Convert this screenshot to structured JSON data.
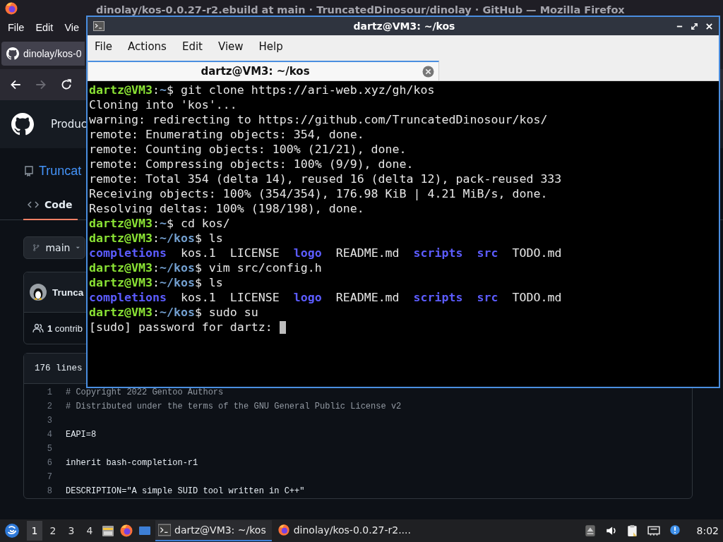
{
  "browser": {
    "title": "dinolay/kos-0.0.27-r2.ebuild at main · TruncatedDinosour/dinolay · GitHub — Mozilla Firefox",
    "menu": [
      {
        "label": "File"
      },
      {
        "label": "Edit"
      },
      {
        "label": "Vie"
      }
    ],
    "tab": {
      "title": "dinolay/kos-0"
    },
    "nav": [
      {
        "kind": "back",
        "disabled": false
      },
      {
        "kind": "forward",
        "disabled": true
      },
      {
        "kind": "reload",
        "disabled": false
      }
    ],
    "github": {
      "header_item": "Produc",
      "repo": "Truncat",
      "tabs": [
        {
          "label": "Code",
          "selected": true
        }
      ],
      "branch": "main",
      "commit_author": "Trunca",
      "contributors_count": "1",
      "contributors_label": "contrib",
      "file_lines": "176 lines",
      "code": [
        {
          "n": "1",
          "kind": "comment",
          "text": "# Copyright 2022 Gentoo Authors"
        },
        {
          "n": "2",
          "kind": "comment",
          "text": "# Distributed under the terms of the GNU General Public License v2"
        },
        {
          "n": "3",
          "kind": "blank"
        },
        {
          "n": "4",
          "kind": "code",
          "text": "EAPI=8"
        },
        {
          "n": "5",
          "kind": "blank"
        },
        {
          "n": "6",
          "kind": "code",
          "text": "inherit bash-completion-r1"
        },
        {
          "n": "7",
          "kind": "blank"
        },
        {
          "n": "8",
          "kind": "code",
          "text": "DESCRIPTION=\"A simple SUID tool written in C++\""
        }
      ]
    }
  },
  "terminal": {
    "title": "dartz@VM3: ~/kos",
    "menu": [
      {
        "label": "File"
      },
      {
        "label": "Actions"
      },
      {
        "label": "Edit"
      },
      {
        "label": "View"
      },
      {
        "label": "Help"
      }
    ],
    "tabs": [
      {
        "title": "dartz@VM3: ~/kos",
        "selected": true
      }
    ],
    "lines": [
      {
        "segments": [
          {
            "kind": "user",
            "text": "dartz@VM3"
          },
          {
            "kind": "plain",
            "text": ":"
          },
          {
            "kind": "path",
            "text": "~"
          },
          {
            "kind": "plain",
            "text": "$ git clone https://ari-web.xyz/gh/kos"
          }
        ]
      },
      {
        "segments": [
          {
            "kind": "plain",
            "text": "Cloning into 'kos'..."
          }
        ]
      },
      {
        "segments": [
          {
            "kind": "plain",
            "text": "warning: redirecting to https://github.com/TruncatedDinosour/kos/"
          }
        ]
      },
      {
        "segments": [
          {
            "kind": "plain",
            "text": "remote: Enumerating objects: 354, done."
          }
        ]
      },
      {
        "segments": [
          {
            "kind": "plain",
            "text": "remote: Counting objects: 100% (21/21), done."
          }
        ]
      },
      {
        "segments": [
          {
            "kind": "plain",
            "text": "remote: Compressing objects: 100% (9/9), done."
          }
        ]
      },
      {
        "segments": [
          {
            "kind": "plain",
            "text": "remote: Total 354 (delta 14), reused 16 (delta 12), pack-reused 333"
          }
        ]
      },
      {
        "segments": [
          {
            "kind": "plain",
            "text": "Receiving objects: 100% (354/354), 176.98 KiB | 4.21 MiB/s, done."
          }
        ]
      },
      {
        "segments": [
          {
            "kind": "plain",
            "text": "Resolving deltas: 100% (198/198), done."
          }
        ]
      },
      {
        "segments": [
          {
            "kind": "user",
            "text": "dartz@VM3"
          },
          {
            "kind": "plain",
            "text": ":"
          },
          {
            "kind": "path",
            "text": "~"
          },
          {
            "kind": "plain",
            "text": "$ cd kos/"
          }
        ]
      },
      {
        "segments": [
          {
            "kind": "user",
            "text": "dartz@VM3"
          },
          {
            "kind": "plain",
            "text": ":"
          },
          {
            "kind": "path",
            "text": "~/kos"
          },
          {
            "kind": "plain",
            "text": "$ ls"
          }
        ]
      },
      {
        "segments": [
          {
            "kind": "dir",
            "text": "completions"
          },
          {
            "kind": "plain",
            "text": "  kos.1  LICENSE  "
          },
          {
            "kind": "dir",
            "text": "logo"
          },
          {
            "kind": "plain",
            "text": "  README.md  "
          },
          {
            "kind": "dir",
            "text": "scripts"
          },
          {
            "kind": "dir",
            "text": "  src"
          },
          {
            "kind": "plain",
            "text": "  TODO.md"
          }
        ]
      },
      {
        "segments": [
          {
            "kind": "user",
            "text": "dartz@VM3"
          },
          {
            "kind": "plain",
            "text": ":"
          },
          {
            "kind": "path",
            "text": "~/kos"
          },
          {
            "kind": "plain",
            "text": "$ vim src/config.h"
          }
        ]
      },
      {
        "segments": [
          {
            "kind": "user",
            "text": "dartz@VM3"
          },
          {
            "kind": "plain",
            "text": ":"
          },
          {
            "kind": "path",
            "text": "~/kos"
          },
          {
            "kind": "plain",
            "text": "$ ls"
          }
        ]
      },
      {
        "segments": [
          {
            "kind": "dir",
            "text": "completions"
          },
          {
            "kind": "plain",
            "text": "  kos.1  LICENSE  "
          },
          {
            "kind": "dir",
            "text": "logo"
          },
          {
            "kind": "plain",
            "text": "  README.md  "
          },
          {
            "kind": "dir",
            "text": "scripts"
          },
          {
            "kind": "dir",
            "text": "  src"
          },
          {
            "kind": "plain",
            "text": "  TODO.md"
          }
        ]
      },
      {
        "segments": [
          {
            "kind": "user",
            "text": "dartz@VM3"
          },
          {
            "kind": "plain",
            "text": ":"
          },
          {
            "kind": "path",
            "text": "~/kos"
          },
          {
            "kind": "plain",
            "text": "$ sudo su"
          }
        ]
      },
      {
        "segments": [
          {
            "kind": "plain",
            "text": "[sudo] password for dartz: "
          }
        ],
        "cursor": true
      }
    ]
  },
  "taskbar": {
    "workspaces": [
      {
        "label": "1",
        "selected": true
      },
      {
        "label": "2",
        "selected": false
      },
      {
        "label": "3",
        "selected": false
      },
      {
        "label": "4",
        "selected": false
      }
    ],
    "tasks": [
      {
        "kind": "terminal",
        "title": "dartz@VM3: ~/kos",
        "selected": true
      },
      {
        "kind": "firefox",
        "title": "dinolay/kos-0.0.27-r2....",
        "selected": false
      }
    ],
    "clock": "8:02"
  }
}
